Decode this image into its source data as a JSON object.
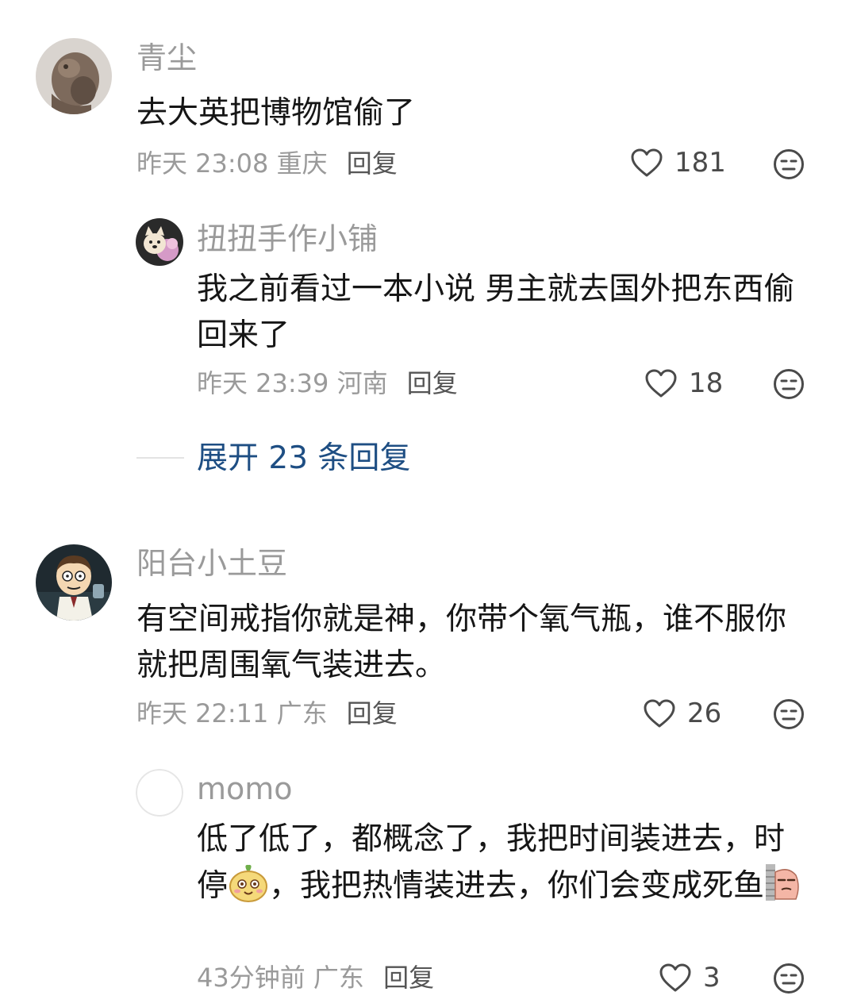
{
  "comments": [
    {
      "username": "青尘",
      "text": "去大英把博物馆偷了",
      "time": "昨天 23:08",
      "location": "重庆",
      "reply_label": "回复",
      "likes": "181",
      "replies": [
        {
          "username": "扭扭手作小铺",
          "text": "我之前看过一本小说 男主就去国外把东西偷回来了",
          "time": "昨天 23:39",
          "location": "河南",
          "reply_label": "回复",
          "likes": "18"
        }
      ],
      "expand_label": "展开 23 条回复"
    },
    {
      "username": "阳台小土豆",
      "text": "有空间戒指你就是神，你带个氧气瓶，谁不服你就把周围氧气装进去。",
      "time": "昨天 22:11",
      "location": "广东",
      "reply_label": "回复",
      "likes": "26",
      "replies": [
        {
          "username": "momo",
          "text_part1": "低了低了，都概念了，我把时间装进去，时停",
          "text_part2": "，我把热情装进去，你们会变成死鱼",
          "time": "43分钟前",
          "location": "广东",
          "reply_label": "回复",
          "likes": "3"
        }
      ]
    }
  ],
  "icons": {
    "like": "heart-outline-icon",
    "dislike": "neutral-face-icon"
  },
  "colors": {
    "link": "#1e4e83",
    "muted": "#9a9a9a",
    "text": "#161616"
  }
}
